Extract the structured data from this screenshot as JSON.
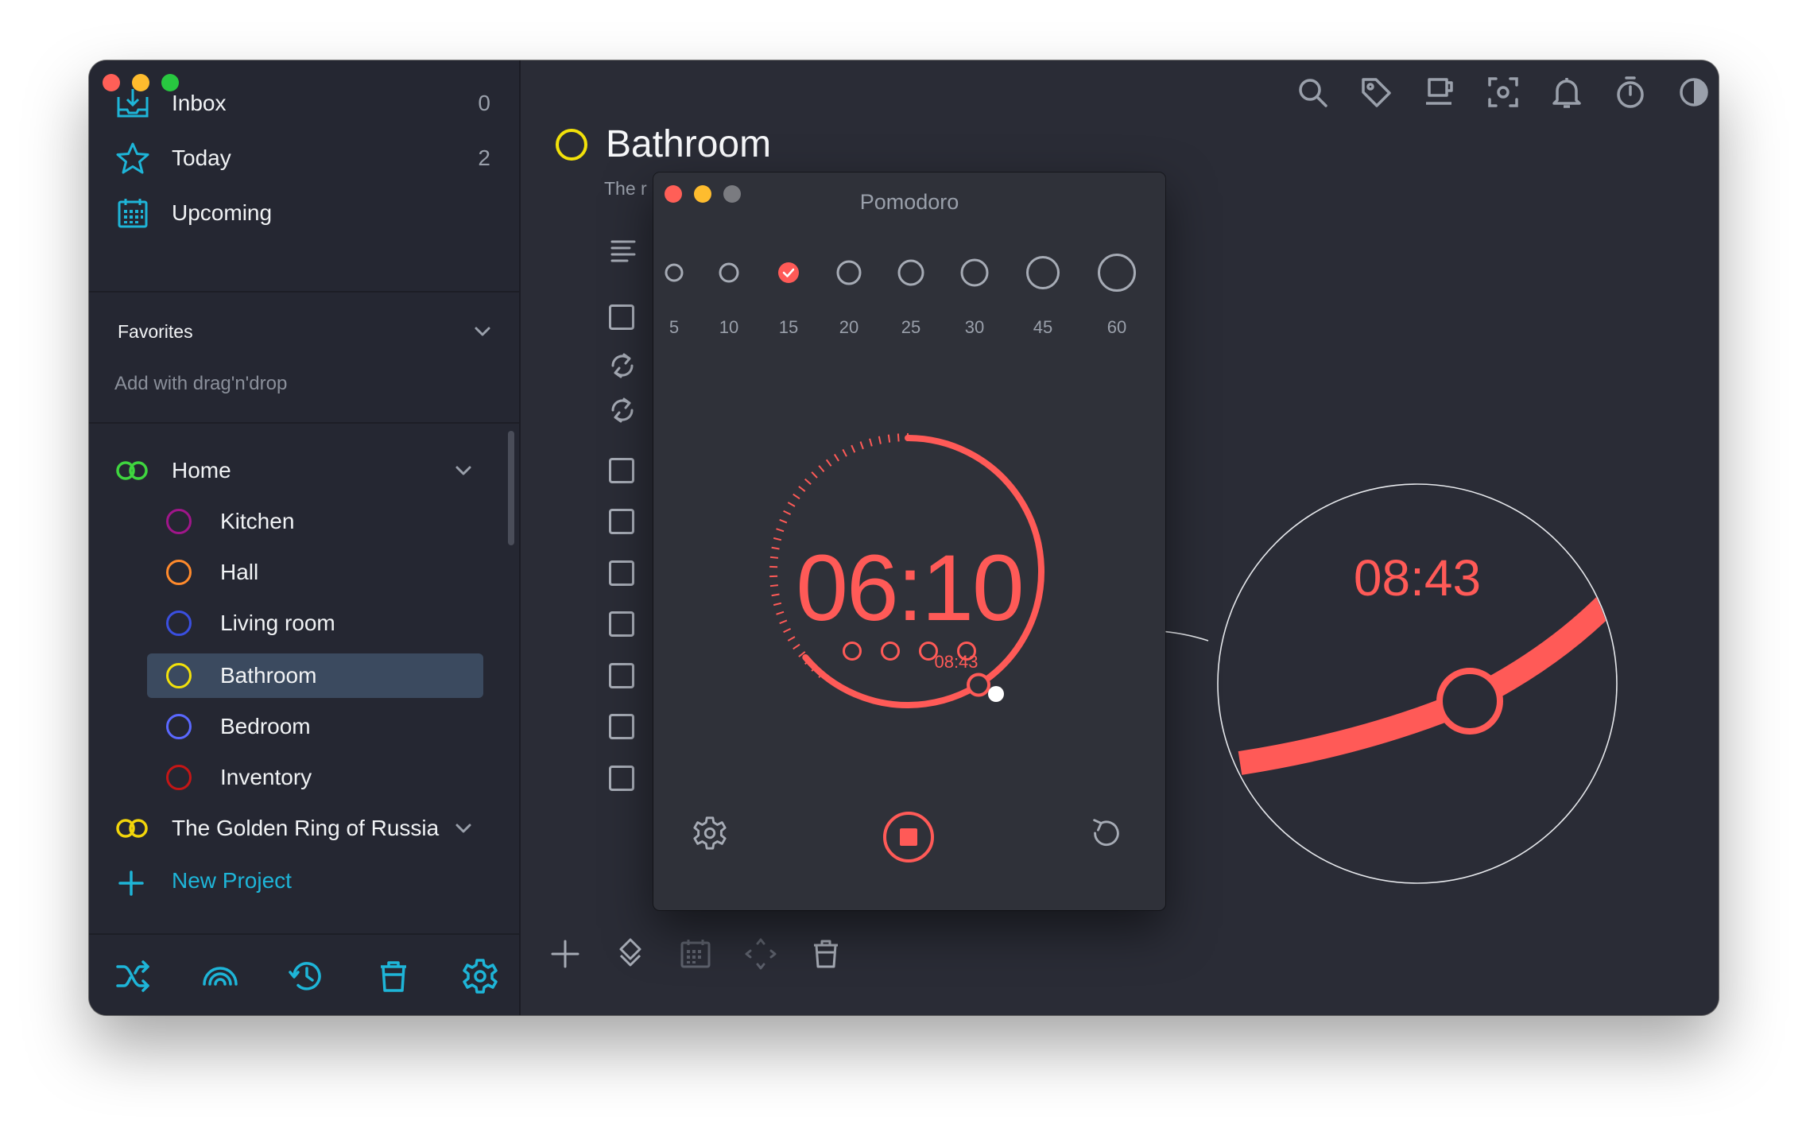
{
  "sidebar": {
    "nav": [
      {
        "label": "Inbox",
        "count": "0",
        "icon": "inbox-tray-icon"
      },
      {
        "label": "Today",
        "count": "2",
        "icon": "star-icon"
      },
      {
        "label": "Upcoming",
        "count": "",
        "icon": "calendar-icon"
      }
    ],
    "favorites_title": "Favorites",
    "favorites_hint": "Add with drag'n'drop",
    "groups": [
      {
        "label": "Home",
        "color": "#3fd63f"
      },
      {
        "label": "The Golden Ring of Russia",
        "color": "#f2d50a"
      }
    ],
    "projects": [
      {
        "label": "Kitchen",
        "color": "#a0168a"
      },
      {
        "label": "Hall",
        "color": "#ff8a2c"
      },
      {
        "label": "Living room",
        "color": "#3a4fe0"
      },
      {
        "label": "Bathroom",
        "color": "#f2e10a"
      },
      {
        "label": "Bedroom",
        "color": "#5a68ff"
      },
      {
        "label": "Inventory",
        "color": "#c41616"
      }
    ],
    "new_project": "New Project",
    "bottom_icons": [
      "shuffle-icon",
      "rainbow-icon",
      "history-icon",
      "trash-icon",
      "settings-icon"
    ]
  },
  "header": {
    "icons": [
      "search-icon",
      "tag-icon",
      "coffee-icon",
      "focus-icon",
      "bell-icon",
      "timer-icon",
      "contrast-icon",
      "copy-windows-icon"
    ]
  },
  "project": {
    "title": "Bathroom",
    "subtitle": "The r",
    "ring_color": "#f2e10a"
  },
  "pomodoro": {
    "title": "Pomodoro",
    "presets": [
      "5",
      "10",
      "15",
      "20",
      "25",
      "30",
      "45",
      "60"
    ],
    "selected_preset": "15",
    "time": "06:10",
    "marker_time": "08:43",
    "zoom_time": "08:43",
    "sessions": 4,
    "accent": "#ff5a57",
    "buttons": [
      "settings-icon",
      "stop-button",
      "reset-icon"
    ]
  },
  "main_bottom_icons": [
    "add-icon",
    "move-icon",
    "calendar-icon",
    "arrows-icon",
    "trash-icon",
    "cloud-icon"
  ]
}
